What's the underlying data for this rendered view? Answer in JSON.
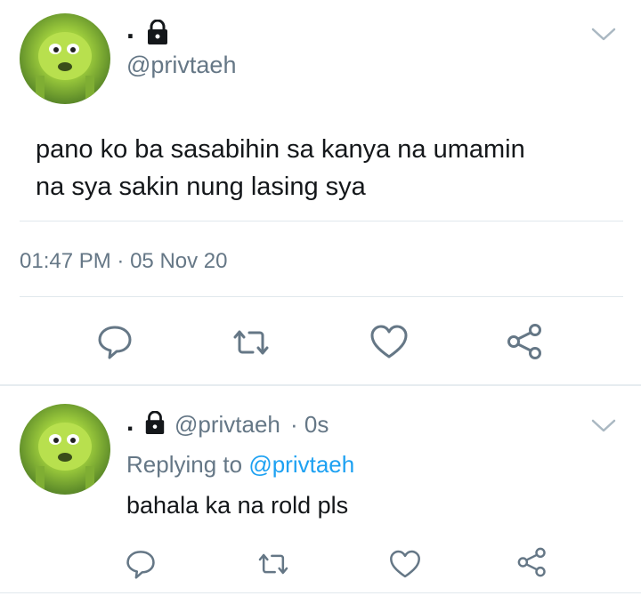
{
  "main_tweet": {
    "display_name": ".",
    "handle": "@privtaeh",
    "text_line1": "pano ko ba sasabihin sa kanya na umamin",
    "text_line2": "na sya sakin nung lasing sya",
    "time": "01:47 PM",
    "separator": "·",
    "date": "05 Nov 20"
  },
  "reply": {
    "display_name": ".",
    "handle": "@privtaeh",
    "age": "· 0s",
    "replying_prefix": "Replying to",
    "replying_handle": "@privtaeh",
    "text": "bahala ka na rold pls"
  },
  "icons": {
    "verified_lock": "lock-icon",
    "menu": "chevron-down-icon",
    "reply": "reply-icon",
    "retweet": "retweet-icon",
    "like": "heart-icon",
    "share": "share-icon"
  },
  "colors": {
    "text": "#14171a",
    "secondary": "#657786",
    "link": "#1da1f2",
    "divider": "#e1e8ed"
  }
}
